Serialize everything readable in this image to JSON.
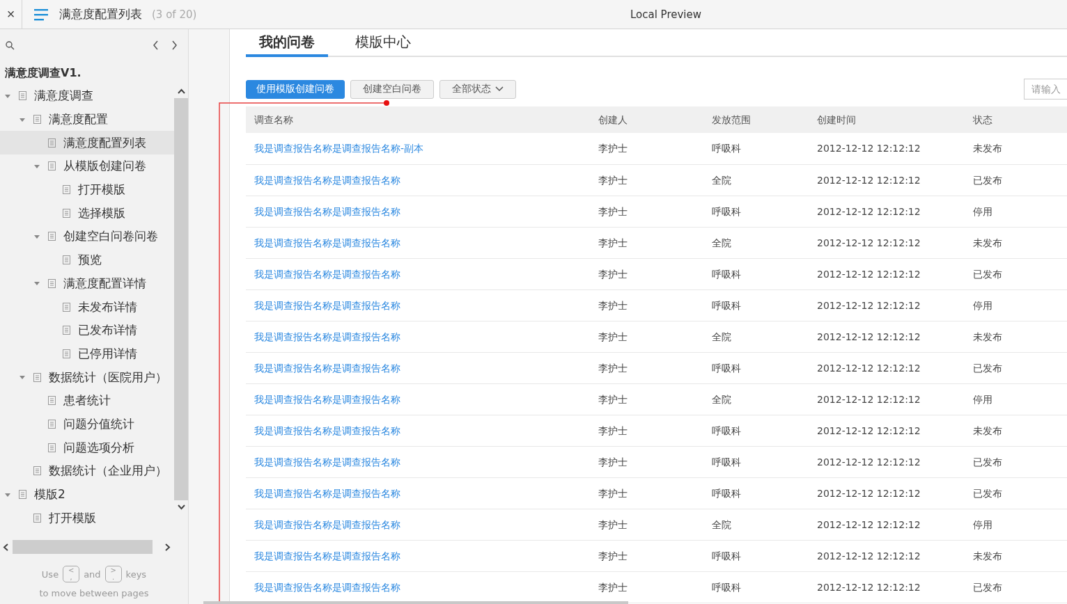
{
  "top_bar": {
    "close": "×",
    "page_title": "满意度配置列表",
    "page_count": "(3 of 20)",
    "window_title": "Local Preview"
  },
  "sidebar": {
    "project": "满意度调查V1.",
    "tree": [
      {
        "label": "满意度调查",
        "expanded": true,
        "selected": false,
        "children": [
          {
            "label": "满意度配置",
            "expanded": true,
            "selected": false,
            "children": [
              {
                "label": "满意度配置列表",
                "selected": true
              },
              {
                "label": "从模版创建问卷",
                "expanded": true,
                "selected": false,
                "children": [
                  {
                    "label": "打开模版",
                    "selected": false
                  },
                  {
                    "label": "选择模版",
                    "selected": false
                  }
                ]
              },
              {
                "label": "创建空白问卷问卷",
                "expanded": true,
                "selected": false,
                "children": [
                  {
                    "label": "预览",
                    "selected": false
                  }
                ]
              },
              {
                "label": "满意度配置详情",
                "expanded": true,
                "selected": false,
                "children": [
                  {
                    "label": "未发布详情",
                    "selected": false
                  },
                  {
                    "label": "已发布详情",
                    "selected": false
                  },
                  {
                    "label": "已停用详情",
                    "selected": false
                  }
                ]
              }
            ]
          },
          {
            "label": "数据统计（医院用户）",
            "expanded": true,
            "selected": false,
            "children": [
              {
                "label": "患者统计",
                "selected": false
              },
              {
                "label": "问题分值统计",
                "selected": false
              },
              {
                "label": "问题选项分析",
                "selected": false
              }
            ]
          },
          {
            "label": "数据统计（企业用户）",
            "selected": false
          }
        ]
      },
      {
        "label": "模版2",
        "expanded": true,
        "selected": false,
        "children": [
          {
            "label": "打开模版",
            "selected": false
          }
        ]
      }
    ],
    "hint": {
      "use": "Use",
      "key_prev": {
        "top": "<",
        "bottom": ","
      },
      "and": "and",
      "key_next": {
        "top": ">",
        "bottom": "."
      },
      "keys": "keys",
      "line_2": "to move between pages"
    }
  },
  "tabs": [
    {
      "label": "我的问卷",
      "selected": true
    },
    {
      "label": "模版中心",
      "selected": false
    }
  ],
  "toolbar": {
    "primary_button": "使用模版创建问卷",
    "secondary_button": "创建空白问卷",
    "status_filter": "全部状态",
    "search": {
      "placeholder": "请输入"
    }
  },
  "table": {
    "columns": [
      "调查名称",
      "创建人",
      "发放范围",
      "创建时间",
      "状态"
    ],
    "rows": [
      [
        "我是调查报告名称是调查报告名称-副本",
        "李护士",
        "呼吸科",
        "2012-12-12 12:12:12",
        "未发布"
      ],
      [
        "我是调查报告名称是调查报告名称",
        "李护士",
        "全院",
        "2012-12-12 12:12:12",
        "已发布"
      ],
      [
        "我是调查报告名称是调查报告名称",
        "李护士",
        "呼吸科",
        "2012-12-12 12:12:12",
        "停用"
      ],
      [
        "我是调查报告名称是调查报告名称",
        "李护士",
        "全院",
        "2012-12-12 12:12:12",
        "未发布"
      ],
      [
        "我是调查报告名称是调查报告名称",
        "李护士",
        "呼吸科",
        "2012-12-12 12:12:12",
        "已发布"
      ],
      [
        "我是调查报告名称是调查报告名称",
        "李护士",
        "呼吸科",
        "2012-12-12 12:12:12",
        "停用"
      ],
      [
        "我是调查报告名称是调查报告名称",
        "李护士",
        "全院",
        "2012-12-12 12:12:12",
        "未发布"
      ],
      [
        "我是调查报告名称是调查报告名称",
        "李护士",
        "呼吸科",
        "2012-12-12 12:12:12",
        "已发布"
      ],
      [
        "我是调查报告名称是调查报告名称",
        "李护士",
        "全院",
        "2012-12-12 12:12:12",
        "停用"
      ],
      [
        "我是调查报告名称是调查报告名称",
        "李护士",
        "呼吸科",
        "2012-12-12 12:12:12",
        "未发布"
      ],
      [
        "我是调查报告名称是调查报告名称",
        "李护士",
        "呼吸科",
        "2012-12-12 12:12:12",
        "已发布"
      ],
      [
        "我是调查报告名称是调查报告名称",
        "李护士",
        "呼吸科",
        "2012-12-12 12:12:12",
        "已发布"
      ],
      [
        "我是调查报告名称是调查报告名称",
        "李护士",
        "全院",
        "2012-12-12 12:12:12",
        "停用"
      ],
      [
        "我是调查报告名称是调查报告名称",
        "李护士",
        "呼吸科",
        "2012-12-12 12:12:12",
        "未发布"
      ],
      [
        "我是调查报告名称是调查报告名称",
        "李护士",
        "呼吸科",
        "2012-12-12 12:12:12",
        "已发布"
      ]
    ]
  }
}
